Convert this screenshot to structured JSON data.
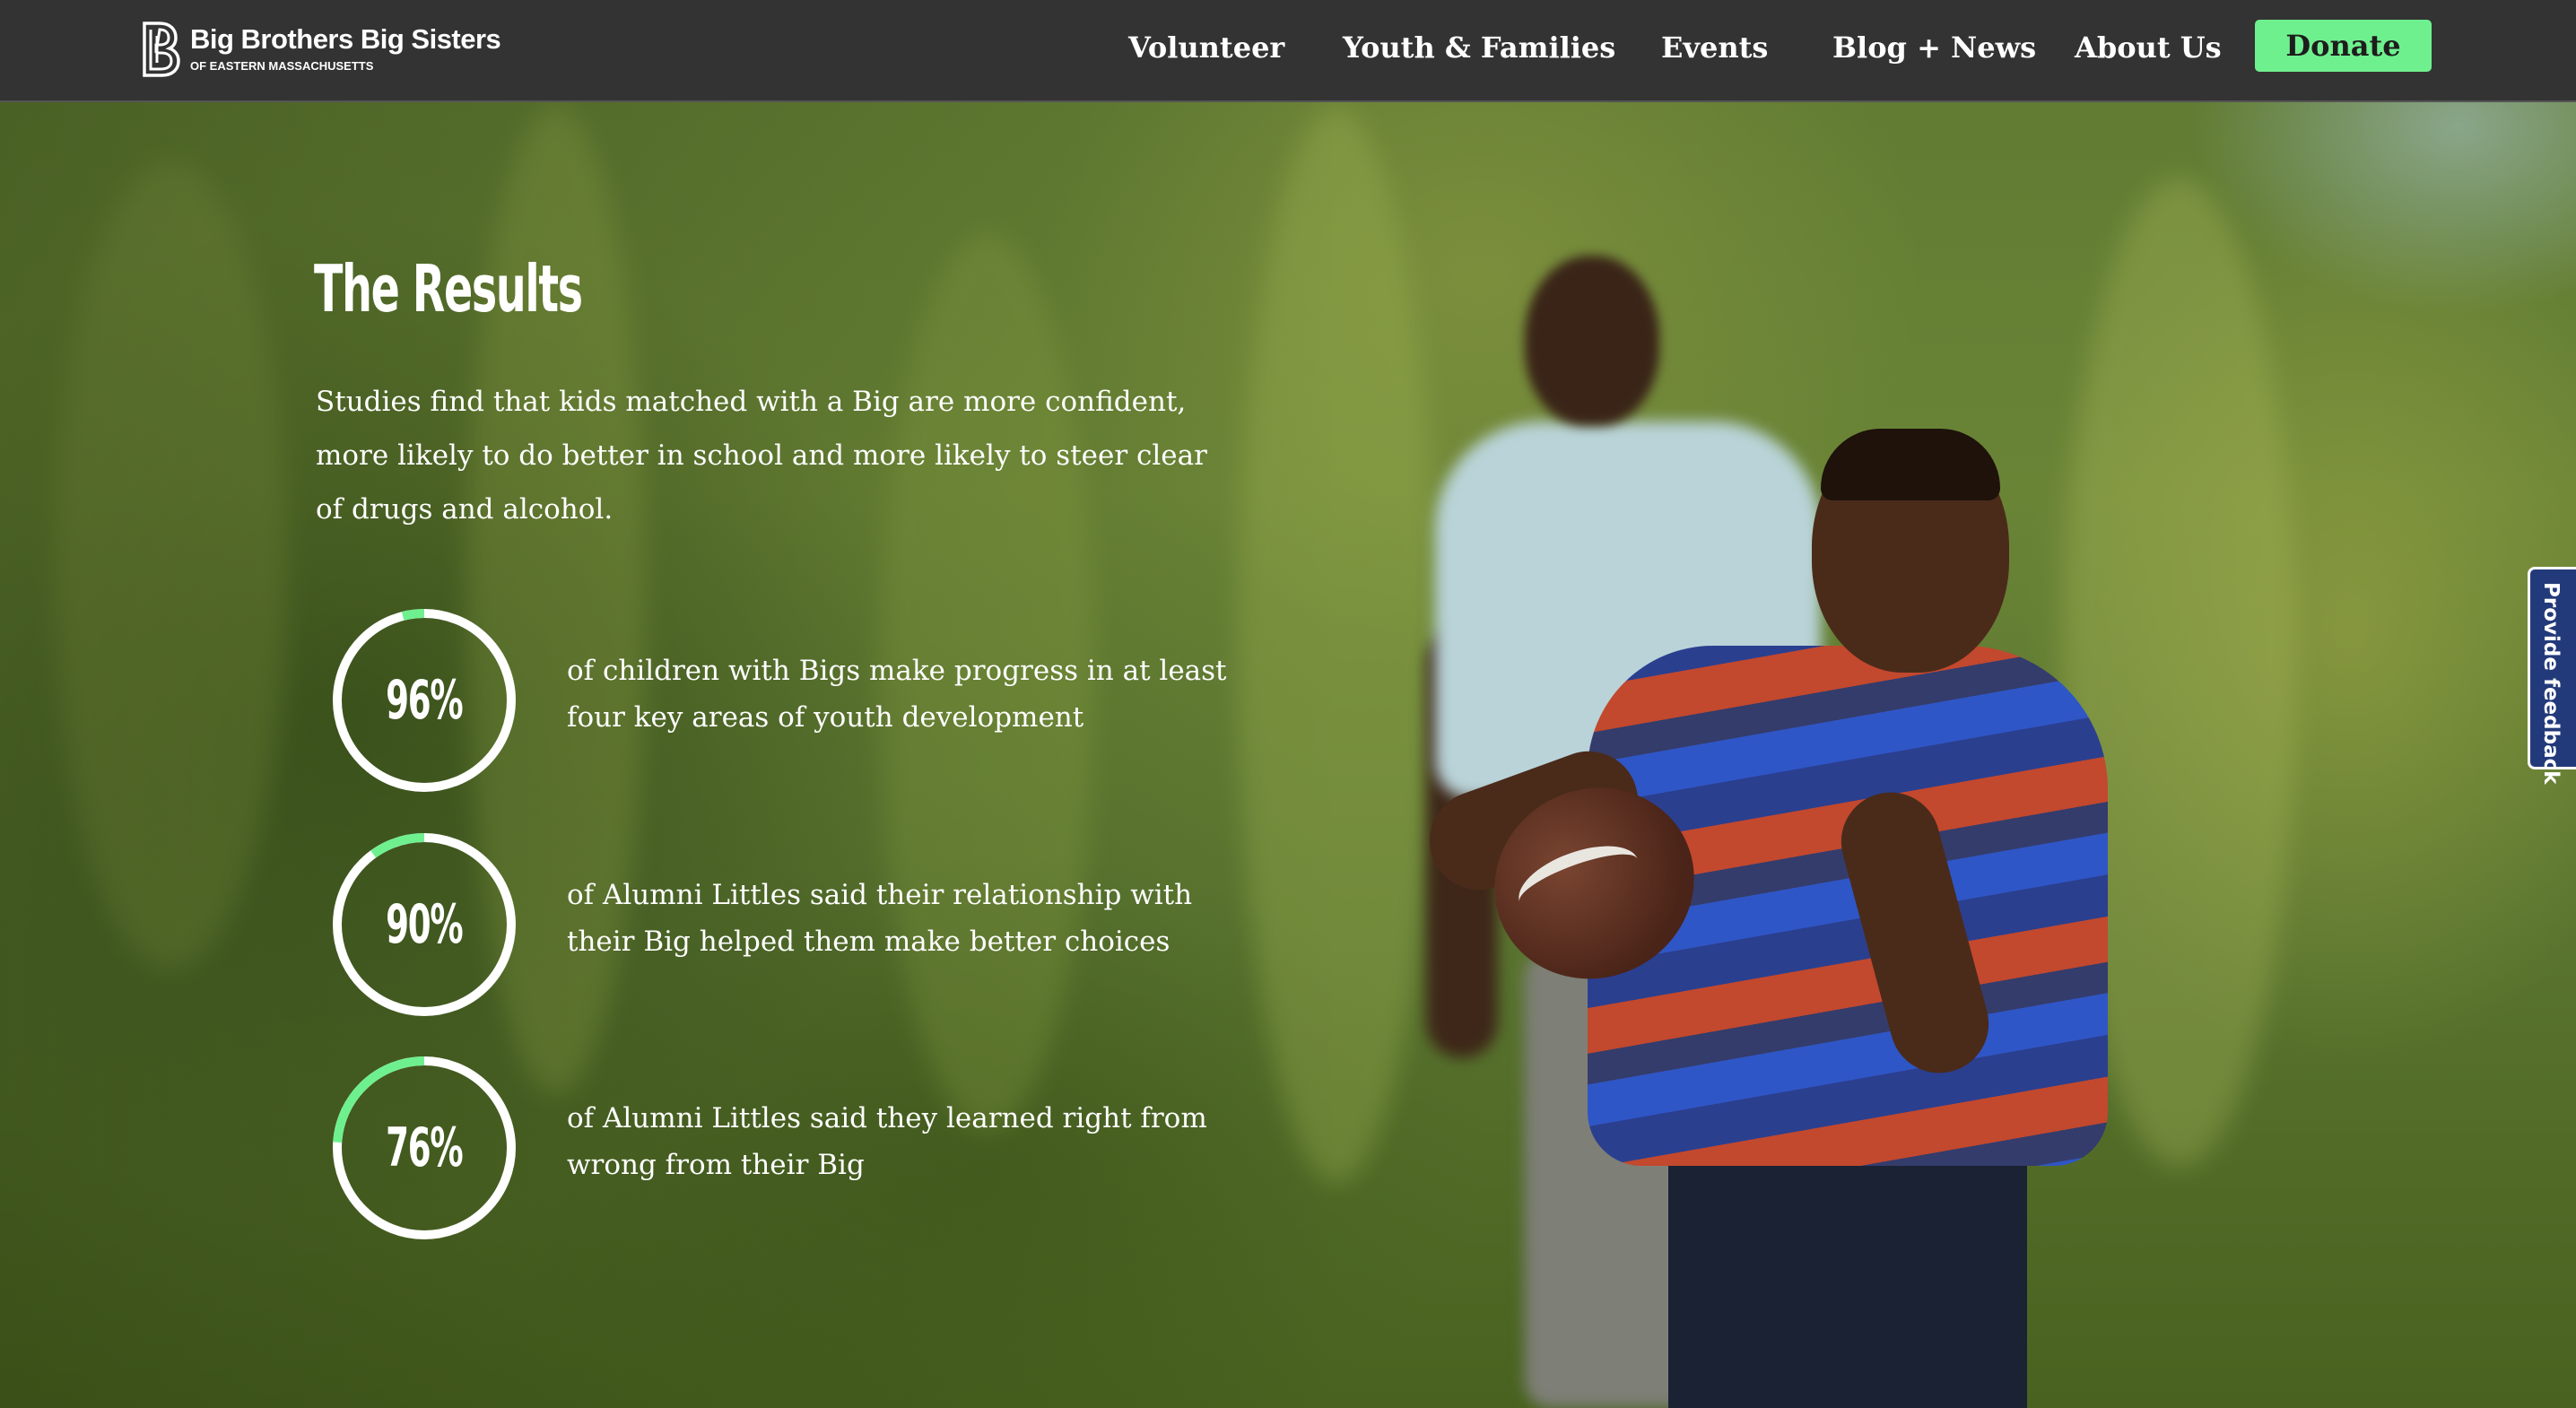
{
  "header": {
    "logo": {
      "name": "Big Brothers Big Sisters",
      "subtitle": "OF EASTERN MASSACHUSETTS",
      "icon": "bbbs-logo-icon"
    },
    "nav": [
      {
        "label": "Volunteer"
      },
      {
        "label": "Youth & Families"
      },
      {
        "label": "Events"
      },
      {
        "label": "Blog + News"
      },
      {
        "label": "About Us"
      }
    ],
    "donate_label": "Donate"
  },
  "results": {
    "title": "The Results",
    "intro": "Studies find that kids matched with a Big are more confident, more likely to do better in school and more likely to steer clear of drugs and alcohol.",
    "stats": [
      {
        "value_label": "96%",
        "percent": 96,
        "text": "of children with Bigs make progress in at least four key areas of youth development"
      },
      {
        "value_label": "90%",
        "percent": 90,
        "text": "of Alumni Littles said their relationship with their Big helped them make better choices"
      },
      {
        "value_label": "76%",
        "percent": 76,
        "text": "of Alumni Littles said they learned right from wrong from their Big"
      }
    ]
  },
  "feedback_tab": {
    "label": "Provide feedback"
  },
  "colors": {
    "header_bg": "#333333",
    "accent_green": "#6ff08f",
    "ring_track": "#ffffff",
    "feedback_bg": "#233a7a"
  }
}
